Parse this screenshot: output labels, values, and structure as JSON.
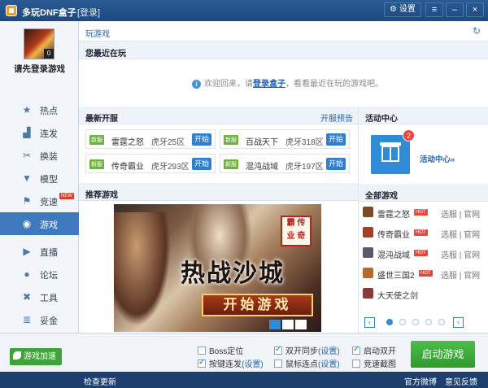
{
  "titlebar": {
    "title": "多玩DNF盒子",
    "login_link": "[登录]",
    "settings_icon": "gear-icon",
    "settings_label": "设置",
    "menu_icon": "menu-lines-icon",
    "minimize_icon": "minimize-icon",
    "close_icon": "close-icon"
  },
  "sidebar": {
    "avatar_level": "0",
    "login_prompt": "请先登录游戏",
    "items": [
      {
        "label": "热点",
        "icon": "star-icon"
      },
      {
        "label": "连发",
        "icon": "blocks-icon"
      },
      {
        "label": "换装",
        "icon": "outfit-icon"
      },
      {
        "label": "模型",
        "icon": "shirt-icon"
      },
      {
        "label": "竞速",
        "icon": "flag-icon",
        "badge": "NEW"
      },
      {
        "label": "游戏",
        "icon": "gamepad-icon",
        "active": true
      },
      {
        "label": "直播",
        "icon": "play-icon"
      },
      {
        "label": "论坛",
        "icon": "chat-icon"
      },
      {
        "label": "工具",
        "icon": "tools-icon"
      },
      {
        "label": "妥金",
        "icon": "coins-icon"
      }
    ]
  },
  "main": {
    "breadcrumb": "玩游戏",
    "refresh_icon": "refresh-icon",
    "recent": {
      "title": "您最近在玩",
      "msg_before": "欢迎回来，请",
      "msg_link": "登录盒子",
      "msg_after": "，看看最近在玩的游戏吧。"
    },
    "servers": {
      "title": "最新开服",
      "preview_link": "开服预告",
      "items": [
        {
          "tag": "新服",
          "game": "雷霆之怒",
          "server": "虎牙25区",
          "action": "开始"
        },
        {
          "tag": "新服",
          "game": "百战天下",
          "server": "虎牙318区",
          "action": "开始"
        },
        {
          "tag": "新服",
          "game": "传奇霸业",
          "server": "虎牙293区",
          "action": "开始"
        },
        {
          "tag": "新服",
          "game": "混沌战域",
          "server": "虎牙197区",
          "action": "开始"
        }
      ]
    },
    "activity": {
      "title": "活动中心",
      "badge": "2",
      "icon": "gift-icon",
      "link": "活动中心»"
    },
    "recommend": {
      "title": "推荐游戏",
      "seal_line1": "霸 传",
      "seal_line2": "业 奇",
      "slogan": "热战沙城",
      "cta": "开始游戏",
      "slide_count": 3,
      "active_slide": 1
    },
    "all_games": {
      "title": "全部游戏",
      "items": [
        {
          "name": "雷霆之怒",
          "hot": "HOT",
          "icon_color": "#7a4a2a"
        },
        {
          "name": "传奇霸业",
          "hot": "HOT",
          "icon_color": "#a3402a"
        },
        {
          "name": "混沌战域",
          "hot": "HOT",
          "icon_color": "#5a5a6a"
        },
        {
          "name": "盛世三国2",
          "hot": "HOT",
          "icon_color": "#b36a2a"
        },
        {
          "name": "大天使之剑",
          "hot": "",
          "icon_color": "#8a3a3a"
        }
      ],
      "link_a": "选服",
      "link_sep": "|",
      "link_b": "官网",
      "prev": "‹",
      "next": "›",
      "page_count": 5,
      "active_page": 1
    }
  },
  "bottom": {
    "accelerate": "游戏加速",
    "options": [
      {
        "label": "Boss定位",
        "checked": false,
        "sub": ""
      },
      {
        "label": "双开同步",
        "checked": true,
        "sub": "(设置)"
      },
      {
        "label": "启动双开",
        "checked": true,
        "sub": ""
      },
      {
        "label": "按键连发",
        "checked": true,
        "sub": "(设置)"
      },
      {
        "label": "鼠标连点",
        "checked": false,
        "sub": "(设置)"
      },
      {
        "label": "竞速截图",
        "checked": false,
        "sub": ""
      }
    ],
    "launch": "启动游戏"
  },
  "statusbar": {
    "update": "检查更新",
    "weibo": "官方微博",
    "feedback": "意见反馈"
  }
}
